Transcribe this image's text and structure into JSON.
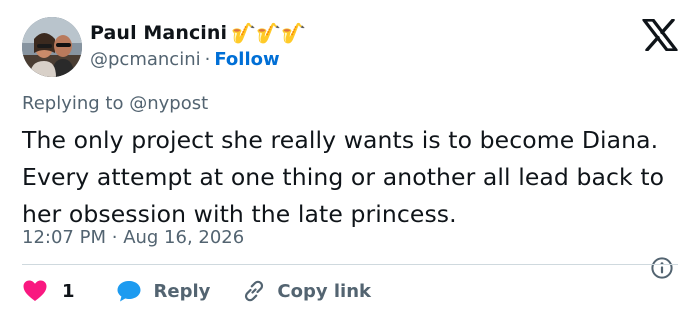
{
  "user": {
    "display_name": "Paul Mancini",
    "name_emojis": "🎷🎷🎷",
    "handle": "@pcmancini",
    "separator": "·",
    "follow_label": "Follow"
  },
  "reply_context": {
    "prefix": "Replying to",
    "target": "@nypost"
  },
  "tweet": {
    "text": "The only project she really wants is to become Diana. Every attempt at one thing or another all lead back to her obsession with the late princess.",
    "time": "12:07 PM",
    "separator": "·",
    "date": "Aug 16, 2026"
  },
  "actions": {
    "like_count": "1",
    "reply_label": "Reply",
    "copy_label": "Copy link"
  },
  "icons": {
    "logo": "x-logo-icon",
    "info": "info-icon",
    "like": "heart-icon",
    "reply": "chat-bubble-icon",
    "copy": "link-icon"
  },
  "colors": {
    "text": "#0f1419",
    "secondary": "#536471",
    "follow": "#006fd6",
    "like": "#f91880",
    "reply_icon": "#1d9bf0",
    "divider": "#cfd9de"
  }
}
